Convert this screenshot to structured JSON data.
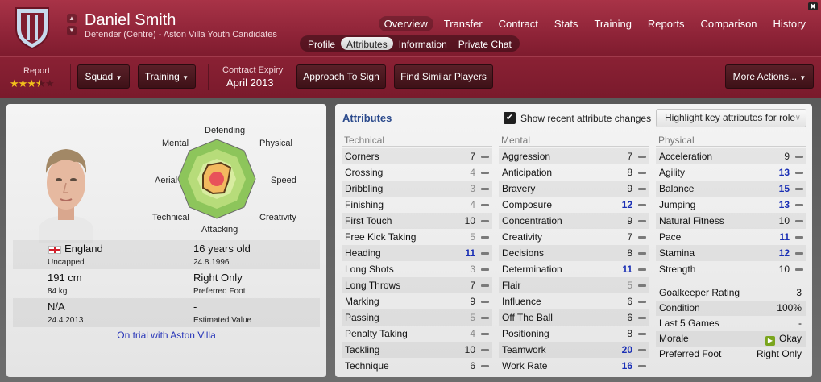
{
  "header": {
    "name": "Daniel Smith",
    "subtitle": "Defender (Centre) - Aston Villa Youth Candidates",
    "nav": [
      "Overview",
      "Transfer",
      "Contract",
      "Stats",
      "Training",
      "Reports",
      "Comparison",
      "History"
    ],
    "active_nav": "Overview",
    "subnav": [
      "Profile",
      "Attributes",
      "Information",
      "Private Chat"
    ],
    "active_subnav": "Attributes"
  },
  "toolbar": {
    "report_label": "Report",
    "stars_filled": 3.5,
    "stars_total": 5,
    "squad_label": "Squad",
    "training_label": "Training",
    "contract_label": "Contract Expiry",
    "contract_value": "April 2013",
    "approach_label": "Approach To Sign",
    "similar_label": "Find Similar Players",
    "more_label": "More Actions..."
  },
  "profile": {
    "radar_labels": {
      "defending": "Defending",
      "physical": "Physical",
      "speed": "Speed",
      "creativity": "Creativity",
      "attacking": "Attacking",
      "technical": "Technical",
      "aerial": "Aerial",
      "mental": "Mental"
    },
    "nationality": "England",
    "age": "16 years old",
    "caps": "Uncapped",
    "dob": "24.8.1996",
    "height": "191 cm",
    "foot": "Right Only",
    "weight": "84 kg",
    "foot_label": "Preferred Foot",
    "value_na": "N/A",
    "value_dash": "-",
    "joined": "24.4.2013",
    "value_label": "Estimated Value",
    "trial": "On trial with Aston Villa"
  },
  "attributes": {
    "title": "Attributes",
    "show_changes_label": "Show recent attribute changes",
    "show_changes_checked": true,
    "highlight_label": "Highlight key attributes for role",
    "technical_title": "Technical",
    "mental_title": "Mental",
    "physical_title": "Physical",
    "technical": [
      {
        "name": "Corners",
        "value": "7",
        "style": "dark"
      },
      {
        "name": "Crossing",
        "value": "4",
        "style": "gray"
      },
      {
        "name": "Dribbling",
        "value": "3",
        "style": "gray"
      },
      {
        "name": "Finishing",
        "value": "4",
        "style": "gray"
      },
      {
        "name": "First Touch",
        "value": "10",
        "style": "dark"
      },
      {
        "name": "Free Kick Taking",
        "value": "5",
        "style": "gray"
      },
      {
        "name": "Heading",
        "value": "11",
        "style": "blue"
      },
      {
        "name": "Long Shots",
        "value": "3",
        "style": "gray"
      },
      {
        "name": "Long Throws",
        "value": "7",
        "style": "dark"
      },
      {
        "name": "Marking",
        "value": "9",
        "style": "dark"
      },
      {
        "name": "Passing",
        "value": "5",
        "style": "gray"
      },
      {
        "name": "Penalty Taking",
        "value": "4",
        "style": "gray"
      },
      {
        "name": "Tackling",
        "value": "10",
        "style": "dark"
      },
      {
        "name": "Technique",
        "value": "6",
        "style": "dark"
      }
    ],
    "mental": [
      {
        "name": "Aggression",
        "value": "7",
        "style": "dark"
      },
      {
        "name": "Anticipation",
        "value": "8",
        "style": "dark"
      },
      {
        "name": "Bravery",
        "value": "9",
        "style": "dark"
      },
      {
        "name": "Composure",
        "value": "12",
        "style": "blue"
      },
      {
        "name": "Concentration",
        "value": "9",
        "style": "dark"
      },
      {
        "name": "Creativity",
        "value": "7",
        "style": "dark"
      },
      {
        "name": "Decisions",
        "value": "8",
        "style": "dark"
      },
      {
        "name": "Determination",
        "value": "11",
        "style": "blue"
      },
      {
        "name": "Flair",
        "value": "5",
        "style": "gray"
      },
      {
        "name": "Influence",
        "value": "6",
        "style": "dark"
      },
      {
        "name": "Off The Ball",
        "value": "6",
        "style": "dark"
      },
      {
        "name": "Positioning",
        "value": "8",
        "style": "dark"
      },
      {
        "name": "Teamwork",
        "value": "20",
        "style": "blue"
      },
      {
        "name": "Work Rate",
        "value": "16",
        "style": "blue"
      }
    ],
    "physical": [
      {
        "name": "Acceleration",
        "value": "9",
        "style": "dark"
      },
      {
        "name": "Agility",
        "value": "13",
        "style": "blue"
      },
      {
        "name": "Balance",
        "value": "15",
        "style": "blue"
      },
      {
        "name": "Jumping",
        "value": "13",
        "style": "blue"
      },
      {
        "name": "Natural Fitness",
        "value": "10",
        "style": "dark"
      },
      {
        "name": "Pace",
        "value": "11",
        "style": "blue"
      },
      {
        "name": "Stamina",
        "value": "12",
        "style": "blue"
      },
      {
        "name": "Strength",
        "value": "10",
        "style": "dark"
      }
    ],
    "summary": [
      {
        "name": "Goalkeeper Rating",
        "value": "3"
      },
      {
        "name": "Condition",
        "value": "100%"
      },
      {
        "name": "Last 5 Games",
        "value": "-"
      },
      {
        "name": "Morale",
        "value": "Okay"
      },
      {
        "name": "Preferred Foot",
        "value": "Right Only"
      }
    ]
  },
  "colors": {
    "header": "#8f2438",
    "blue_value": "#1a2fb5",
    "title_blue": "#2b4a8c"
  }
}
